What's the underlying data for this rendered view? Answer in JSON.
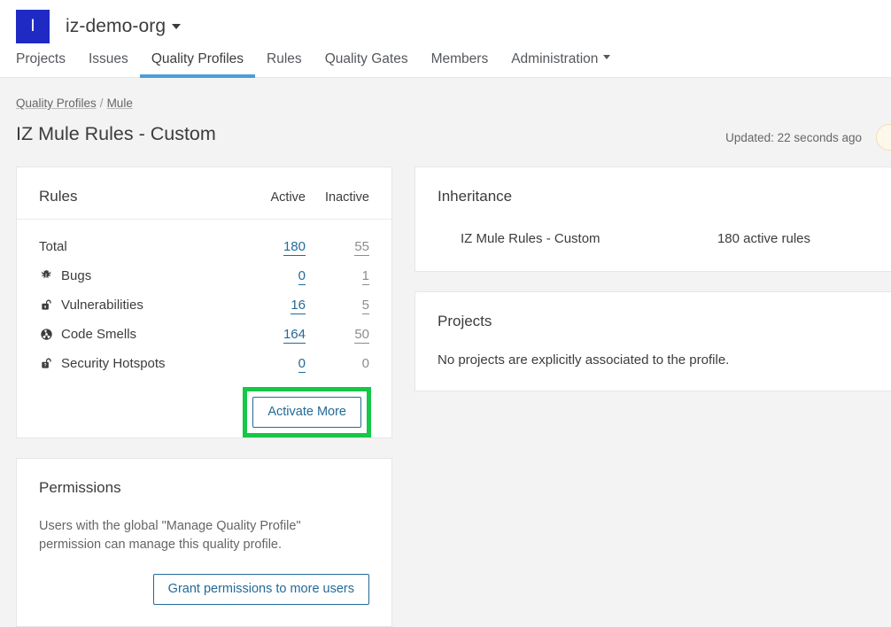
{
  "header": {
    "org_initial": "I",
    "org_name": "iz-demo-org",
    "nav": [
      {
        "label": "Projects",
        "active": false,
        "caret": false
      },
      {
        "label": "Issues",
        "active": false,
        "caret": false
      },
      {
        "label": "Quality Profiles",
        "active": true,
        "caret": false
      },
      {
        "label": "Rules",
        "active": false,
        "caret": false
      },
      {
        "label": "Quality Gates",
        "active": false,
        "caret": false
      },
      {
        "label": "Members",
        "active": false,
        "caret": false
      },
      {
        "label": "Administration",
        "active": false,
        "caret": true
      }
    ]
  },
  "breadcrumb": {
    "root": "Quality Profiles",
    "separator": "/",
    "current": "Mule"
  },
  "page": {
    "title": "IZ Mule Rules - Custom",
    "updated": "Updated: 22 seconds ago"
  },
  "rules_card": {
    "title": "Rules",
    "column_active": "Active",
    "column_inactive": "Inactive",
    "rows": [
      {
        "label": "Total",
        "icon": "",
        "active": "180",
        "inactive": "55",
        "active_link": true,
        "inactive_link": true
      },
      {
        "label": "Bugs",
        "icon": "bug-icon",
        "active": "0",
        "inactive": "1",
        "active_link": true,
        "inactive_link": true
      },
      {
        "label": "Vulnerabilities",
        "icon": "open-padlock-icon",
        "active": "16",
        "inactive": "5",
        "active_link": true,
        "inactive_link": true
      },
      {
        "label": "Code Smells",
        "icon": "code-smell-icon",
        "active": "164",
        "inactive": "50",
        "active_link": true,
        "inactive_link": true
      },
      {
        "label": "Security Hotspots",
        "icon": "security-hotspot-icon",
        "active": "0",
        "inactive": "0",
        "active_link": true,
        "inactive_link": false
      }
    ],
    "activate_more_label": "Activate More",
    "highlight_color": "#16c748"
  },
  "inheritance_card": {
    "title": "Inheritance",
    "profile_name": "IZ Mule Rules - Custom",
    "active_rules": "180 active rules"
  },
  "projects_card": {
    "title": "Projects",
    "empty_message": "No projects are explicitly associated to the profile."
  },
  "permissions_card": {
    "title": "Permissions",
    "description": "Users with the global \"Manage Quality Profile\" permission can manage this quality profile.",
    "grant_button_label": "Grant permissions to more users"
  },
  "theme": {
    "brand_blue": "#1f2ac4",
    "link_blue": "#236a97",
    "tab_underline": "#4b9fd5",
    "page_bg": "#f3f3f3",
    "highlight_green": "#16c748",
    "pill_bg": "#fdf8e9"
  }
}
